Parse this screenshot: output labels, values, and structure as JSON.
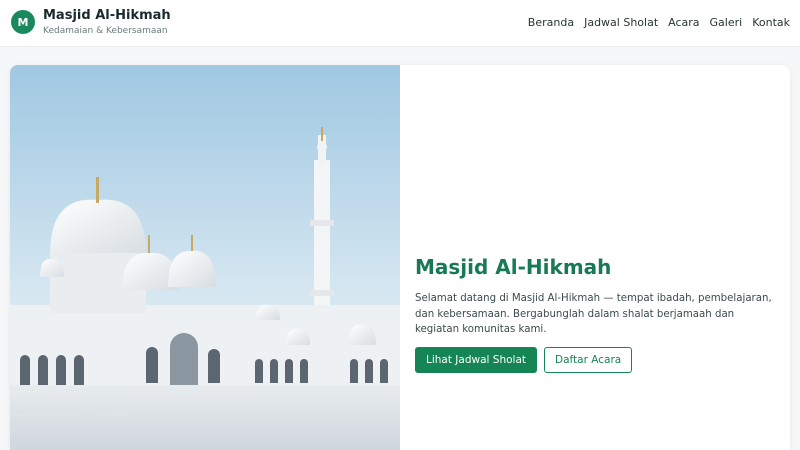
{
  "header": {
    "logo_letter": "M",
    "title": "Masjid Al-Hikmah",
    "tagline": "Kedamaian & Kebersamaan",
    "nav": [
      "Beranda",
      "Jadwal Sholat",
      "Acara",
      "Galeri",
      "Kontak"
    ]
  },
  "hero": {
    "image_icon": "mosque-photo",
    "title": "Masjid Al-Hikmah",
    "description": "Selamat datang di Masjid Al-Hikmah — tempat ibadah, pembelajaran, dan kebersamaan. Bergabunglah dalam shalat berjamaah dan kegiatan komunitas kami.",
    "primary_button": "Lihat Jadwal Sholat",
    "secondary_button": "Daftar Acara"
  },
  "colors": {
    "accent": "#168556",
    "title": "#187a54"
  }
}
